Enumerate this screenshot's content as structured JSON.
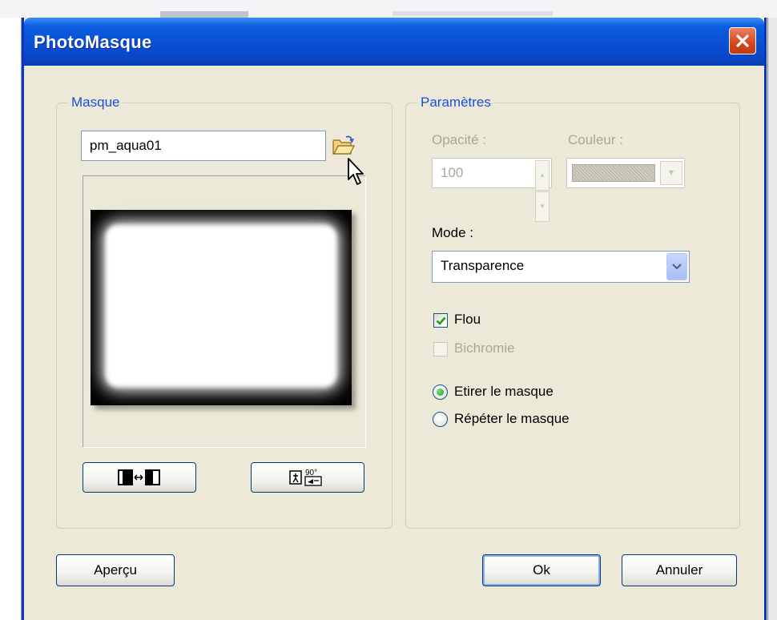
{
  "window": {
    "title": "PhotoMasque"
  },
  "mask_group": {
    "legend": "Masque",
    "file_name": "pm_aqua01",
    "browse_icon": "folder-open-icon",
    "invert_icon": "invert-mask-icon",
    "rotate_icon": "rotate-90-icon",
    "rotate_text": "90°"
  },
  "params_group": {
    "legend": "Paramètres",
    "opacity_label": "Opacité :",
    "opacity_value": "100",
    "color_label": "Couleur :",
    "mode_label": "Mode :",
    "mode_value": "Transparence",
    "blur_label": "Flou",
    "blur_checked": true,
    "bichrome_label": "Bichromie",
    "bichrome_checked": false,
    "stretch_label": "Etirer le masque",
    "repeat_label": "Répéter le masque",
    "selected_fit": "stretch"
  },
  "buttons": {
    "preview": "Aperçu",
    "ok": "Ok",
    "cancel": "Annuler"
  },
  "colors": {
    "title_bar": "#0a4fd4",
    "dialog_bg": "#ece9d8",
    "group_label": "#1e4fd8",
    "close_button": "#d8461c"
  }
}
